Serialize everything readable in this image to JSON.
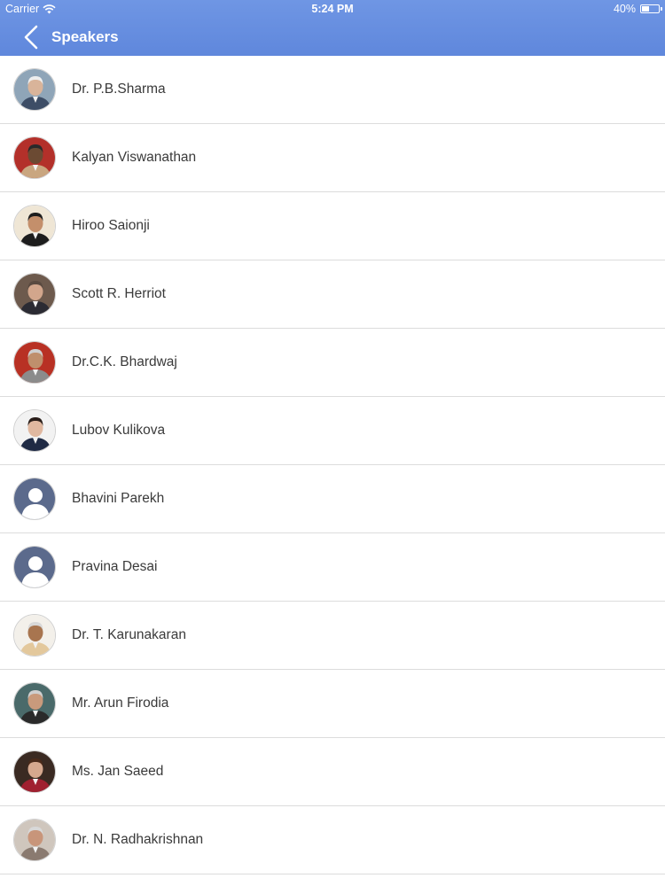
{
  "status_bar": {
    "carrier": "Carrier",
    "time": "5:24 PM",
    "battery": "40%",
    "battery_level": 0.4
  },
  "nav": {
    "title": "Speakers"
  },
  "speakers": [
    {
      "name": "Dr. P.B.Sharma",
      "avatar": "photo",
      "bg": "#8fa5b8",
      "skin": "#d9b49a",
      "hair": "#eeeeee",
      "suit": "#3d4d66"
    },
    {
      "name": "Kalyan Viswanathan",
      "avatar": "photo",
      "bg": "#b3302a",
      "skin": "#6b4a33",
      "hair": "#2a2a2a",
      "suit": "#c9a680"
    },
    {
      "name": "Hiroo Saionji",
      "avatar": "photo",
      "bg": "#efe6d5",
      "skin": "#c48f6b",
      "hair": "#1e1e1e",
      "suit": "#1d1d1d"
    },
    {
      "name": "Scott R. Herriot",
      "avatar": "photo",
      "bg": "#6d5a4d",
      "skin": "#d2a68c",
      "hair": "#5a4a40",
      "suit": "#2b2b33"
    },
    {
      "name": "Dr.C.K. Bhardwaj",
      "avatar": "photo",
      "bg": "#b83124",
      "skin": "#bf8f6c",
      "hair": "#cfcfcf",
      "suit": "#8b8b8b"
    },
    {
      "name": "Lubov Kulikova",
      "avatar": "photo",
      "bg": "#f2f2f2",
      "skin": "#e0b8a0",
      "hair": "#2a1e1a",
      "suit": "#1f2a44"
    },
    {
      "name": "Bhavini Parekh",
      "avatar": "placeholder"
    },
    {
      "name": "Pravina Desai",
      "avatar": "placeholder"
    },
    {
      "name": "Dr. T. Karunakaran",
      "avatar": "photo",
      "bg": "#f3f0ea",
      "skin": "#a8754f",
      "hair": "#d8d8d8",
      "suit": "#e3c89c"
    },
    {
      "name": "Mr. Arun Firodia",
      "avatar": "photo",
      "bg": "#4a6a6a",
      "skin": "#c99a7c",
      "hair": "#cfcfcf",
      "suit": "#2a2a2a"
    },
    {
      "name": "Ms. Jan Saeed",
      "avatar": "photo",
      "bg": "#3a2a22",
      "skin": "#d6a88e",
      "hair": "#4a2a1a",
      "suit": "#a02030"
    },
    {
      "name": "Dr. N. Radhakrishnan",
      "avatar": "photo",
      "bg": "#cfc6bd",
      "skin": "#c8957a",
      "hair": "#d8d8d8",
      "suit": "#8a7a70"
    }
  ],
  "colors": {
    "accent": "#6a90e0",
    "placeholder_bg": "#5b6a8c",
    "placeholder_fg": "#ffffff"
  },
  "icons": {
    "back": "chevron-left-icon",
    "wifi": "wifi-icon",
    "battery": "battery-icon",
    "placeholder": "person-silhouette-icon"
  }
}
